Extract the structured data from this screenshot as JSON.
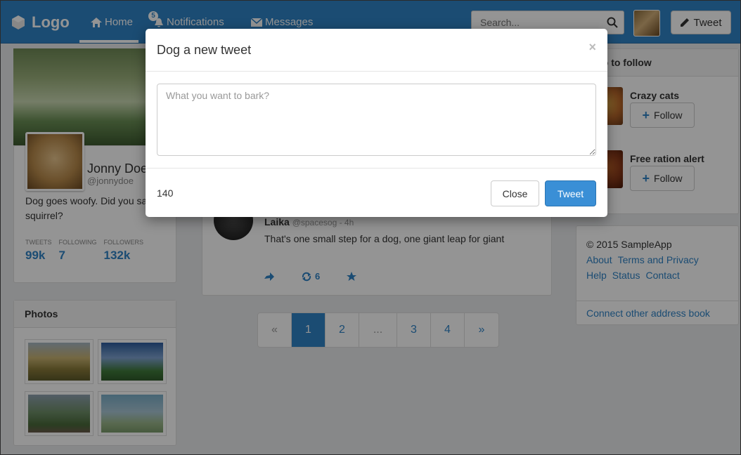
{
  "nav": {
    "brand": "Logo",
    "home": "Home",
    "notifications": "Notifications",
    "notifications_badge": "5",
    "messages": "Messages",
    "search_placeholder": "Search...",
    "tweet_button": "Tweet",
    "accent_color": "#2f83c7"
  },
  "profile": {
    "name": "Jonny Doe",
    "handle": "@jonnydoe",
    "bio": "Dog goes woofy. Did you said squirrel?",
    "stats": [
      {
        "label": "Tweets",
        "value": "99k"
      },
      {
        "label": "Following",
        "value": "7"
      },
      {
        "label": "Followers",
        "value": "132k"
      }
    ]
  },
  "photos": {
    "heading": "Photos"
  },
  "tweet": {
    "author": "Laika",
    "meta": "@spacesog - 4h",
    "text": "That's one small step for a dog, one giant leap for giant",
    "retweets": "6"
  },
  "pagination": {
    "prev": "«",
    "pages": [
      "1",
      "2",
      "...",
      "3",
      "4"
    ],
    "next": "»",
    "active": "1"
  },
  "who_to_follow": {
    "heading": "Who to follow",
    "items": [
      {
        "name": "Crazy cats",
        "button": "Follow"
      },
      {
        "name": "Free ration alert",
        "button": "Follow"
      }
    ]
  },
  "footer": {
    "copyright": "© 2015 SampleApp",
    "links_row1": [
      "About",
      "Terms and Privacy"
    ],
    "links_row2": [
      "Help",
      "Status",
      "Contact"
    ],
    "connect": "Connect other address book"
  },
  "modal": {
    "title": "Dog a new tweet",
    "close_symbol": "×",
    "textarea_placeholder": "What you want to bark?",
    "char_count": "140",
    "close_button": "Close",
    "tweet_button": "Tweet"
  }
}
